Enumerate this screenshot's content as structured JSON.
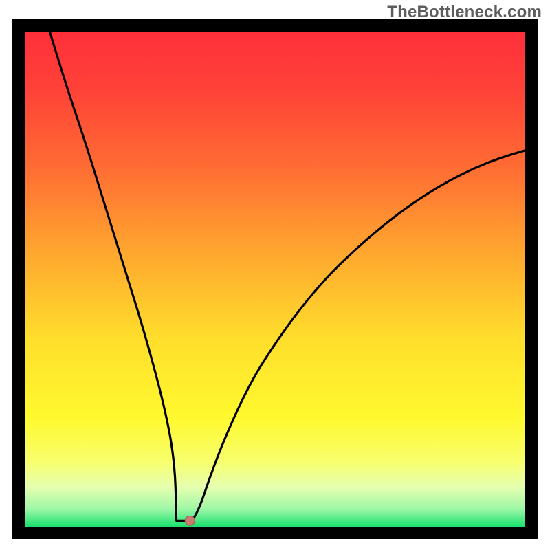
{
  "watermark": "TheBottleneck.com",
  "colors": {
    "frame": "#000000",
    "curve": "#000000",
    "marker_fill": "#c97b70",
    "marker_stroke": "#a95a4f",
    "gradient_stops": [
      {
        "offset": 0.0,
        "color": "#ff2f3a"
      },
      {
        "offset": 0.12,
        "color": "#ff4238"
      },
      {
        "offset": 0.28,
        "color": "#ff6e33"
      },
      {
        "offset": 0.45,
        "color": "#ffa82f"
      },
      {
        "offset": 0.62,
        "color": "#ffde2c"
      },
      {
        "offset": 0.78,
        "color": "#fff92e"
      },
      {
        "offset": 0.87,
        "color": "#f7ff6e"
      },
      {
        "offset": 0.92,
        "color": "#e6ffb0"
      },
      {
        "offset": 0.965,
        "color": "#9cf7a6"
      },
      {
        "offset": 1.0,
        "color": "#19e06e"
      }
    ]
  },
  "chart_data": {
    "type": "line",
    "title": "",
    "xlabel": "",
    "ylabel": "",
    "xlim": [
      0,
      100
    ],
    "ylim": [
      0,
      100
    ],
    "grid": false,
    "legend": null,
    "series": [
      {
        "name": "bottleneck-curve",
        "x": [
          5,
          8,
          12,
          16,
          20,
          24,
          28,
          30,
          31.5,
          32.5,
          33.5,
          35,
          37,
          40,
          45,
          50,
          55,
          60,
          65,
          70,
          75,
          80,
          85,
          90,
          95,
          100
        ],
        "y": [
          100,
          90,
          78,
          65,
          52,
          39,
          24,
          13,
          5,
          1.2,
          1.2,
          4,
          10,
          18,
          29,
          37,
          44,
          50,
          55,
          59.5,
          63.5,
          67,
          70,
          72.5,
          74.5,
          76
        ]
      }
    ],
    "marker": {
      "x": 33,
      "y": 1.2,
      "name": "optimal-point"
    },
    "floor_band": {
      "x0": 30.3,
      "x1": 33.5,
      "y": 1.2
    }
  }
}
